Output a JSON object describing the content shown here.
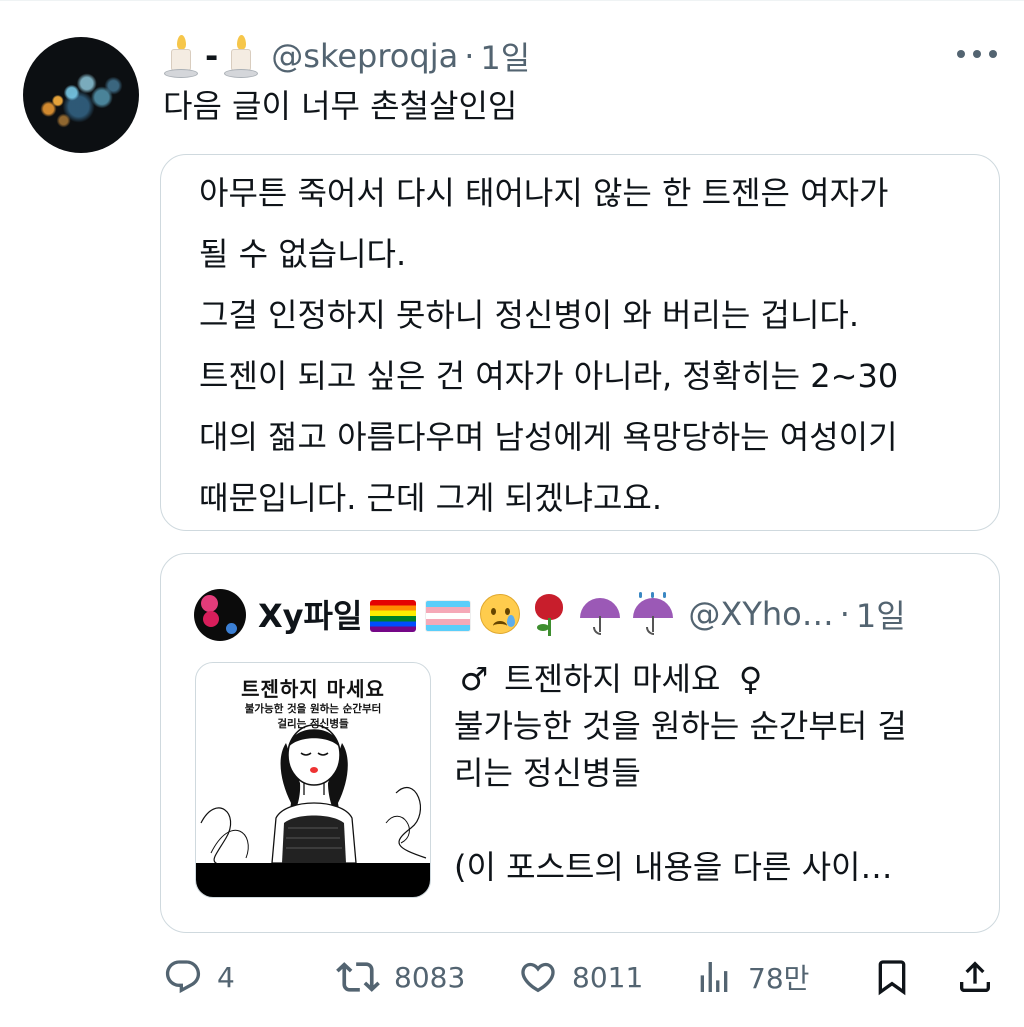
{
  "post": {
    "display_name": "-",
    "handle": "@skeproqja",
    "separator": "·",
    "time": "1일",
    "text": "다음 글이 너무 촌철살인임",
    "quoted_image_text": [
      "아무튼 죽어서 다시 태어나지 않는 한 트젠은 여자가",
      "될 수 없습니다.",
      "그걸 인정하지 못하니 정신병이 와 버리는 겁니다.",
      "트젠이 되고 싶은 건 여자가 아니라, 정확히는 2~30",
      "대의 젊고 아름다우며 남성에게 욕망당하는 여성이기",
      "때문입니다. 근데 그게 되겠냐고요."
    ]
  },
  "quote": {
    "display_name": "Xy파일",
    "handle": "@XYho…",
    "separator": "·",
    "time": "1일",
    "emojis": [
      "rainbow-flag-icon",
      "transgender-flag-icon",
      "sad-tear-face-icon",
      "rose-icon",
      "umbrella-icon",
      "umbrella-rain-icon"
    ],
    "male_symbol": "♂",
    "female_symbol": "♀",
    "line1_text": "트젠하지 마세요",
    "line2": "불가능한 것을 원하는 순간부터 걸",
    "line3": "리는 정신병들",
    "line4": "(이 포스트의 내용을 다른 사이…",
    "thumb_title": "트젠하지 마세요",
    "thumb_sub1": "불가능한 것을 원하는 순간부터",
    "thumb_sub2": "걸리는 정신병들"
  },
  "actions": {
    "reply_count": "4",
    "retweet_count": "8083",
    "like_count": "8011",
    "views_count": "78만"
  },
  "colors": {
    "text": "#0f1419",
    "muted": "#536471",
    "border": "#cfd9de"
  }
}
